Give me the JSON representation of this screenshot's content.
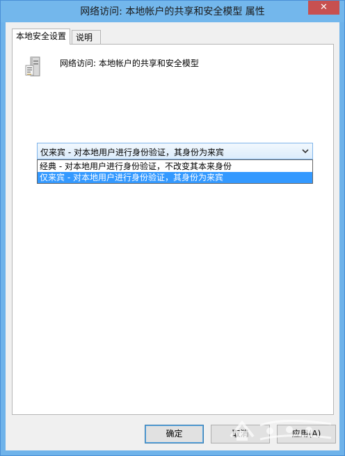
{
  "window": {
    "title": "网络访问: 本地帐户的共享和安全模型 属性",
    "close_glyph": "✕"
  },
  "tabs": [
    {
      "label": "本地安全设置",
      "active": true
    },
    {
      "label": "说明",
      "active": false
    }
  ],
  "policy": {
    "icon": "server-policy-icon",
    "name": "网络访问: 本地帐户的共享和安全模型"
  },
  "combo": {
    "selected": "仅来宾 - 对本地用户进行身份验证，其身份为来宾",
    "options": [
      "经典 - 对本地用户进行身份验证，不改变其本来身份",
      "仅来宾 - 对本地用户进行身份验证，其身份为来宾"
    ],
    "highlighted_index": 1
  },
  "buttons": {
    "ok": "确定",
    "cancel": "取消",
    "apply": "应用(A)"
  },
  "colors": {
    "titlebar": "#73b7ec",
    "close_button": "#c75050",
    "selection": "#3399ff"
  }
}
